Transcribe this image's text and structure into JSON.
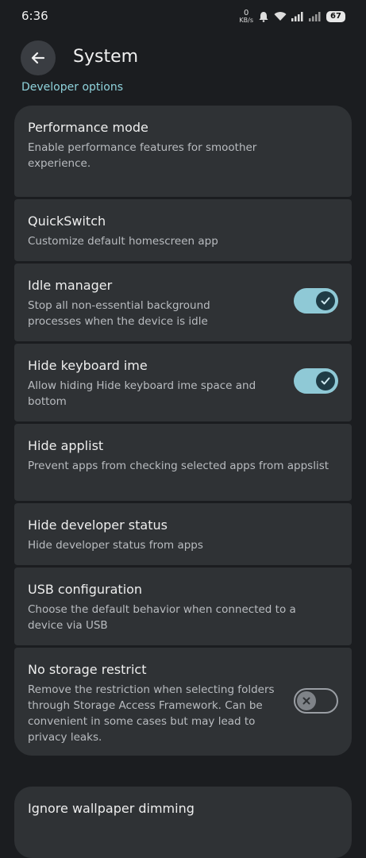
{
  "status": {
    "time": "6:36",
    "net_speed_value": "0",
    "net_speed_unit": "KB/s",
    "battery": "67"
  },
  "app_bar": {
    "title": "System"
  },
  "section": {
    "title": "Developer options"
  },
  "items": [
    {
      "title": "Performance mode",
      "subtitle": "Enable performance features for smoother experience."
    },
    {
      "title": "QuickSwitch",
      "subtitle": "Customize default homescreen app"
    },
    {
      "title": "Idle manager",
      "subtitle": "Stop all non-essential background processes when the device is idle",
      "toggle": "on"
    },
    {
      "title": "Hide keyboard ime",
      "subtitle": "Allow hiding Hide keyboard ime space and bottom",
      "toggle": "on"
    },
    {
      "title": "Hide applist",
      "subtitle": "Prevent apps from checking selected apps from appslist"
    },
    {
      "title": "Hide developer status",
      "subtitle": "Hide developer status from apps"
    },
    {
      "title": "USB configuration",
      "subtitle": "Choose the default behavior when connected to a device via USB"
    },
    {
      "title": "No storage restrict",
      "subtitle": "Remove the restriction when selecting folders through Storage Access Framework. Can be convenient in some cases but may lead to privacy leaks.",
      "toggle": "off"
    },
    {
      "title": "Ignore wallpaper dimming"
    }
  ],
  "icons": {
    "back": "arrow-left-icon",
    "toggle_on": "check-icon",
    "toggle_off": "x-icon"
  },
  "colors": {
    "background": "#1b1d20",
    "card": "#2f3235",
    "accent": "#8fc9d6",
    "section_header": "#8fd3dc"
  }
}
